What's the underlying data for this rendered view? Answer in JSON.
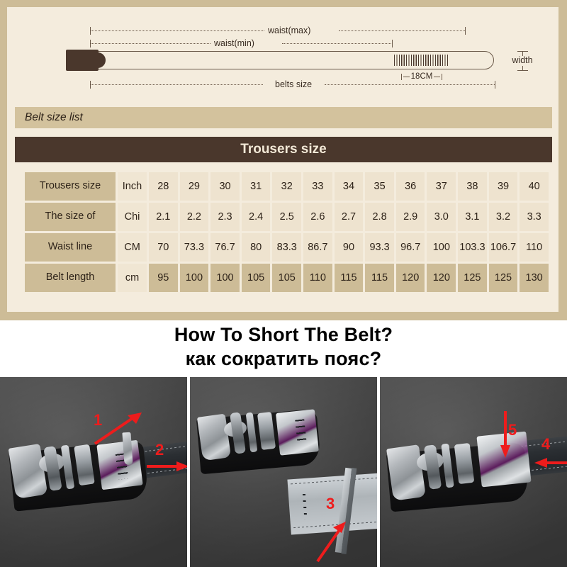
{
  "diagram": {
    "labels": {
      "waist_max": "waist(max)",
      "waist_min": "waist(min)",
      "belts_size": "belts size",
      "length_18cm": "18CM",
      "width": "width"
    }
  },
  "list_bar": {
    "title": "Belt size list"
  },
  "table": {
    "title": "Trousers size",
    "rows": [
      {
        "label": "Trousers size",
        "unit": "Inch",
        "highlight": false,
        "values": [
          "28",
          "29",
          "30",
          "31",
          "32",
          "33",
          "34",
          "35",
          "36",
          "37",
          "38",
          "39",
          "40"
        ]
      },
      {
        "label": "The size of",
        "unit": "Chi",
        "highlight": false,
        "values": [
          "2.1",
          "2.2",
          "2.3",
          "2.4",
          "2.5",
          "2.6",
          "2.7",
          "2.8",
          "2.9",
          "3.0",
          "3.1",
          "3.2",
          "3.3"
        ]
      },
      {
        "label": "Waist line",
        "unit": "CM",
        "highlight": false,
        "values": [
          "70",
          "73.3",
          "76.7",
          "80",
          "83.3",
          "86.7",
          "90",
          "93.3",
          "96.7",
          "100",
          "103.3",
          "106.7",
          "110"
        ]
      },
      {
        "label": "Belt length",
        "unit": "cm",
        "highlight": true,
        "values": [
          "95",
          "100",
          "100",
          "105",
          "105",
          "110",
          "115",
          "115",
          "120",
          "120",
          "125",
          "125",
          "130"
        ]
      }
    ]
  },
  "headline": {
    "line1": "How To Short The Belt?",
    "line2": "как сократить пояс?"
  },
  "photos": [
    {
      "step_numbers": [
        "1",
        "2"
      ]
    },
    {
      "step_numbers": [
        "3"
      ]
    },
    {
      "step_numbers": [
        "5",
        "4"
      ]
    }
  ],
  "colors": {
    "card_border": "#cdbc97",
    "card_bg": "#f4ecdd",
    "bar_tan": "#d3c29d",
    "dark_brown": "#4a372c",
    "cell_light": "#eee3cf",
    "cell_tan": "#cdbc97",
    "arrow_red": "#ee1c1c"
  }
}
